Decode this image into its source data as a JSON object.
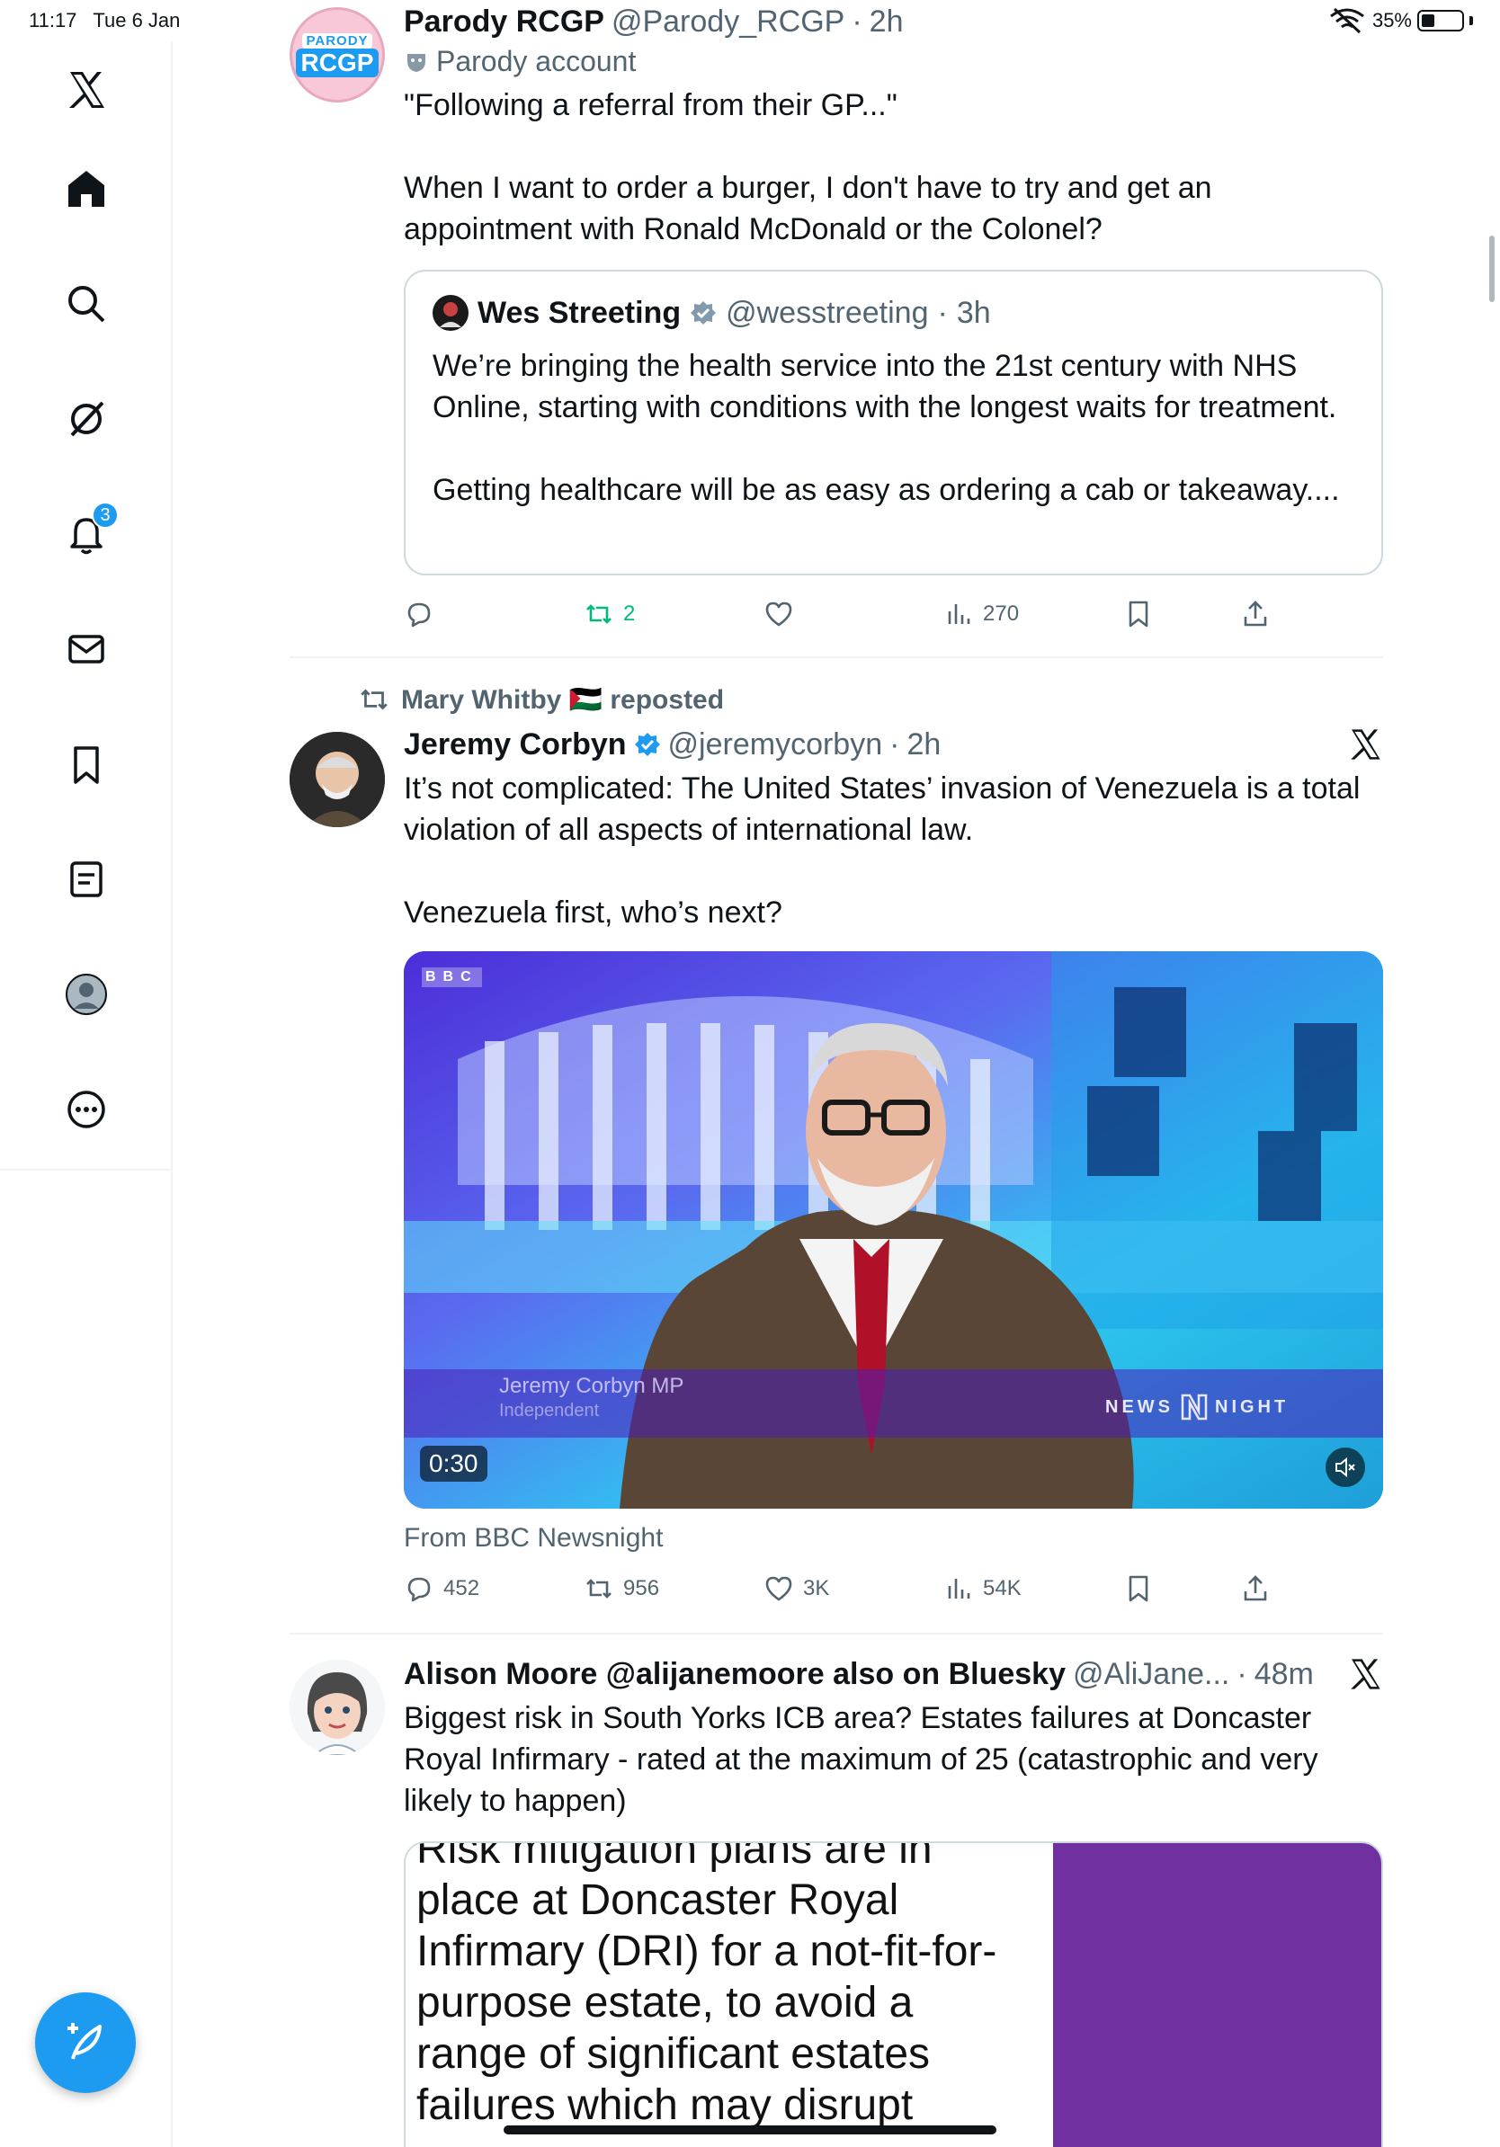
{
  "status_bar": {
    "time": "11:17",
    "date": "Tue 6 Jan",
    "battery": "35%"
  },
  "sidebar": {
    "items": [
      {
        "name": "x-logo"
      },
      {
        "name": "home"
      },
      {
        "name": "explore"
      },
      {
        "name": "grok"
      },
      {
        "name": "notifications",
        "badge": "3"
      },
      {
        "name": "messages"
      },
      {
        "name": "bookmarks"
      },
      {
        "name": "lists"
      },
      {
        "name": "profile"
      },
      {
        "name": "more"
      }
    ]
  },
  "tweets": [
    {
      "display_name": "Parody RCGP",
      "handle": "@Parody_RCGP",
      "time": "2h",
      "avatar_label_top": "PARODY",
      "avatar_label_main": "RCGP",
      "parody_label": "Parody account",
      "text": "\"Following a referral from their GP...\"\n\nWhen I want to order a burger, I don't have to try and get an appointment with Ronald McDonald or the Colonel?",
      "quote": {
        "display_name": "Wes Streeting",
        "handle": "@wesstreeting",
        "time": "3h",
        "text": "We’re bringing the health service into the 21st century with NHS Online, starting with conditions with the longest waits for treatment.\n\nGetting healthcare will be as easy as ordering a cab or takeaway...."
      },
      "stats": {
        "replies": "",
        "reposts": "2",
        "likes": "",
        "views": "270"
      }
    },
    {
      "reposted_by": "Mary Whitby 🇵🇸 reposted",
      "display_name": "Jeremy Corbyn",
      "handle": "@jeremycorbyn",
      "time": "2h",
      "text": "It’s not complicated: The United States’ invasion of Venezuela is a total violation of all aspects of international law.\n\nVenezuela first, who’s next?",
      "video": {
        "lower_third_name": "Jeremy Corbyn MP",
        "lower_third_role": "Independent",
        "watermark_left": "NEWS",
        "watermark_right": "NIGHT",
        "channel_logo": "BBC",
        "duration": "0:30"
      },
      "source": "From BBC Newsnight",
      "stats": {
        "replies": "452",
        "reposts": "956",
        "likes": "3K",
        "views": "54K"
      }
    },
    {
      "display_name": "Alison Moore @alijanemoore also on Bluesky",
      "handle": "@AliJane...",
      "time": "48m",
      "text": "Biggest risk in South Yorks ICB area? Estates failures at Doncaster Royal Infirmary - rated at the maximum of 25 (catastrophic and very likely to happen)",
      "image_text": "Risk mitigation plans are in\nplace at Doncaster Royal\nInfirmary (DRI) for a not-fit-for-\npurpose estate, to avoid a\nrange of significant estates\nfailures which may disrupt"
    }
  ],
  "colors": {
    "accent": "#1d9bf0",
    "text_primary": "#0f1419",
    "text_secondary": "#536471",
    "repost_green": "#00ba7c",
    "border": "#cfd9de",
    "image_purple": "#7030a0"
  }
}
